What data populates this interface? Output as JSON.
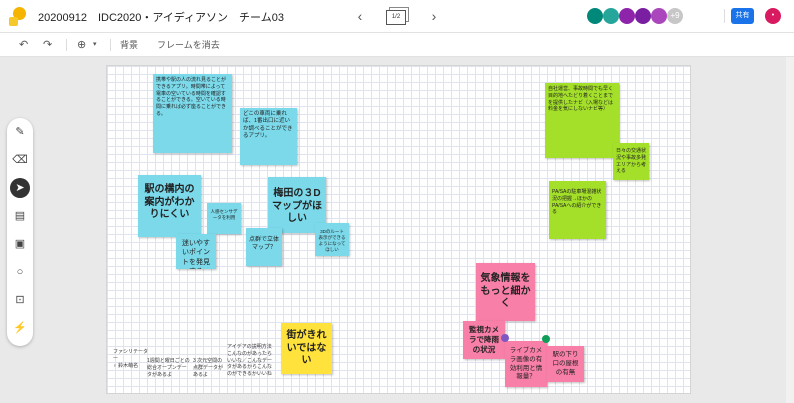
{
  "header": {
    "title": "20200912　IDC2020・アイディアソン　チーム03",
    "prev_icon": "‹",
    "next_icon": "›",
    "page_indicator": "1/2",
    "avatars": [
      {
        "initial": "",
        "color": "#00897b"
      },
      {
        "initial": "",
        "color": "#009688"
      },
      {
        "initial": "",
        "color": "#8e24aa"
      },
      {
        "initial": "",
        "color": "#7b1fa2"
      },
      {
        "initial": "",
        "color": "#ab47bc"
      },
      {
        "initial": "+9",
        "color": "#c7c7c7"
      }
    ],
    "share_label": "共有",
    "user_initial": "•"
  },
  "toolbar": {
    "undo_icon": "↶",
    "redo_icon": "↷",
    "zoom_icon": "⊕",
    "zoom_caret": "▾",
    "background_label": "背景",
    "clear_frame_label": "フレームを消去"
  },
  "tools": [
    "pen",
    "eraser",
    "select",
    "sticky-note",
    "image",
    "circle",
    "text-box",
    "laser"
  ],
  "notes": [
    {
      "id": "n1",
      "color": "cyan",
      "text": "携帯や駅の人の流れ見ることができるアプリ。時間帯によって電車の空いている時間を確認することができる。空いている時間に乗れば必ず座ることができる。"
    },
    {
      "id": "n2",
      "color": "cyan",
      "text": "どこの車両に乗れば、1番出口に近いか調べることができるアプリ。"
    },
    {
      "id": "n3",
      "color": "cyan",
      "text": "駅の構内の案内がわかりにくい"
    },
    {
      "id": "n4",
      "color": "cyan",
      "text": "人感センサデータを利用"
    },
    {
      "id": "n5",
      "color": "cyan",
      "text": "迷いやすいポイントを発見する"
    },
    {
      "id": "n6",
      "color": "cyan",
      "text": "梅田の３Dマップがほしい"
    },
    {
      "id": "n7",
      "color": "cyan",
      "text": "点群で立体マップ？"
    },
    {
      "id": "n8",
      "color": "cyan",
      "text": "3Dのルート表示ができるようになってほしい"
    },
    {
      "id": "n9",
      "color": "lime",
      "text": "自社運営、事故時間でも早く目的地へたどり着くことまでを提供したナビ（入場などは料金を気にしないナビ等）"
    },
    {
      "id": "n10",
      "color": "lime",
      "text": "日々の交通状況や事故多発エリアから考える"
    },
    {
      "id": "n11",
      "color": "lime",
      "text": "PA/SAの駐車場混雑状況の把握→ほかのPA/SAへの紹介ができる"
    },
    {
      "id": "n12",
      "color": "pink",
      "text": "気象情報をもっと細かく"
    },
    {
      "id": "n13",
      "color": "pink",
      "text": "監視カメラで降雨の状況"
    },
    {
      "id": "n14",
      "color": "pink",
      "text": "ライブカメラ画像の有効利用と情報量？"
    },
    {
      "id": "n15",
      "color": "pink",
      "text": "駅の下り口の屋根の有無"
    },
    {
      "id": "n16",
      "color": "yellow",
      "text": "街がきれいではない"
    }
  ],
  "free_texts": [
    {
      "id": "t1",
      "text": "ファシリテーター\n ♀ 鈴木萌名"
    },
    {
      "id": "t2",
      "text": "1週間と曜日ごとの総合オープンデータがあるよ"
    },
    {
      "id": "t3",
      "text": "3 次元空間の点群データがあるよ"
    },
    {
      "id": "t4",
      "text": "アイデアの説明方法 こんなのがあったらいいな／こんなデータがあるからこんなのができるかいいね"
    }
  ]
}
